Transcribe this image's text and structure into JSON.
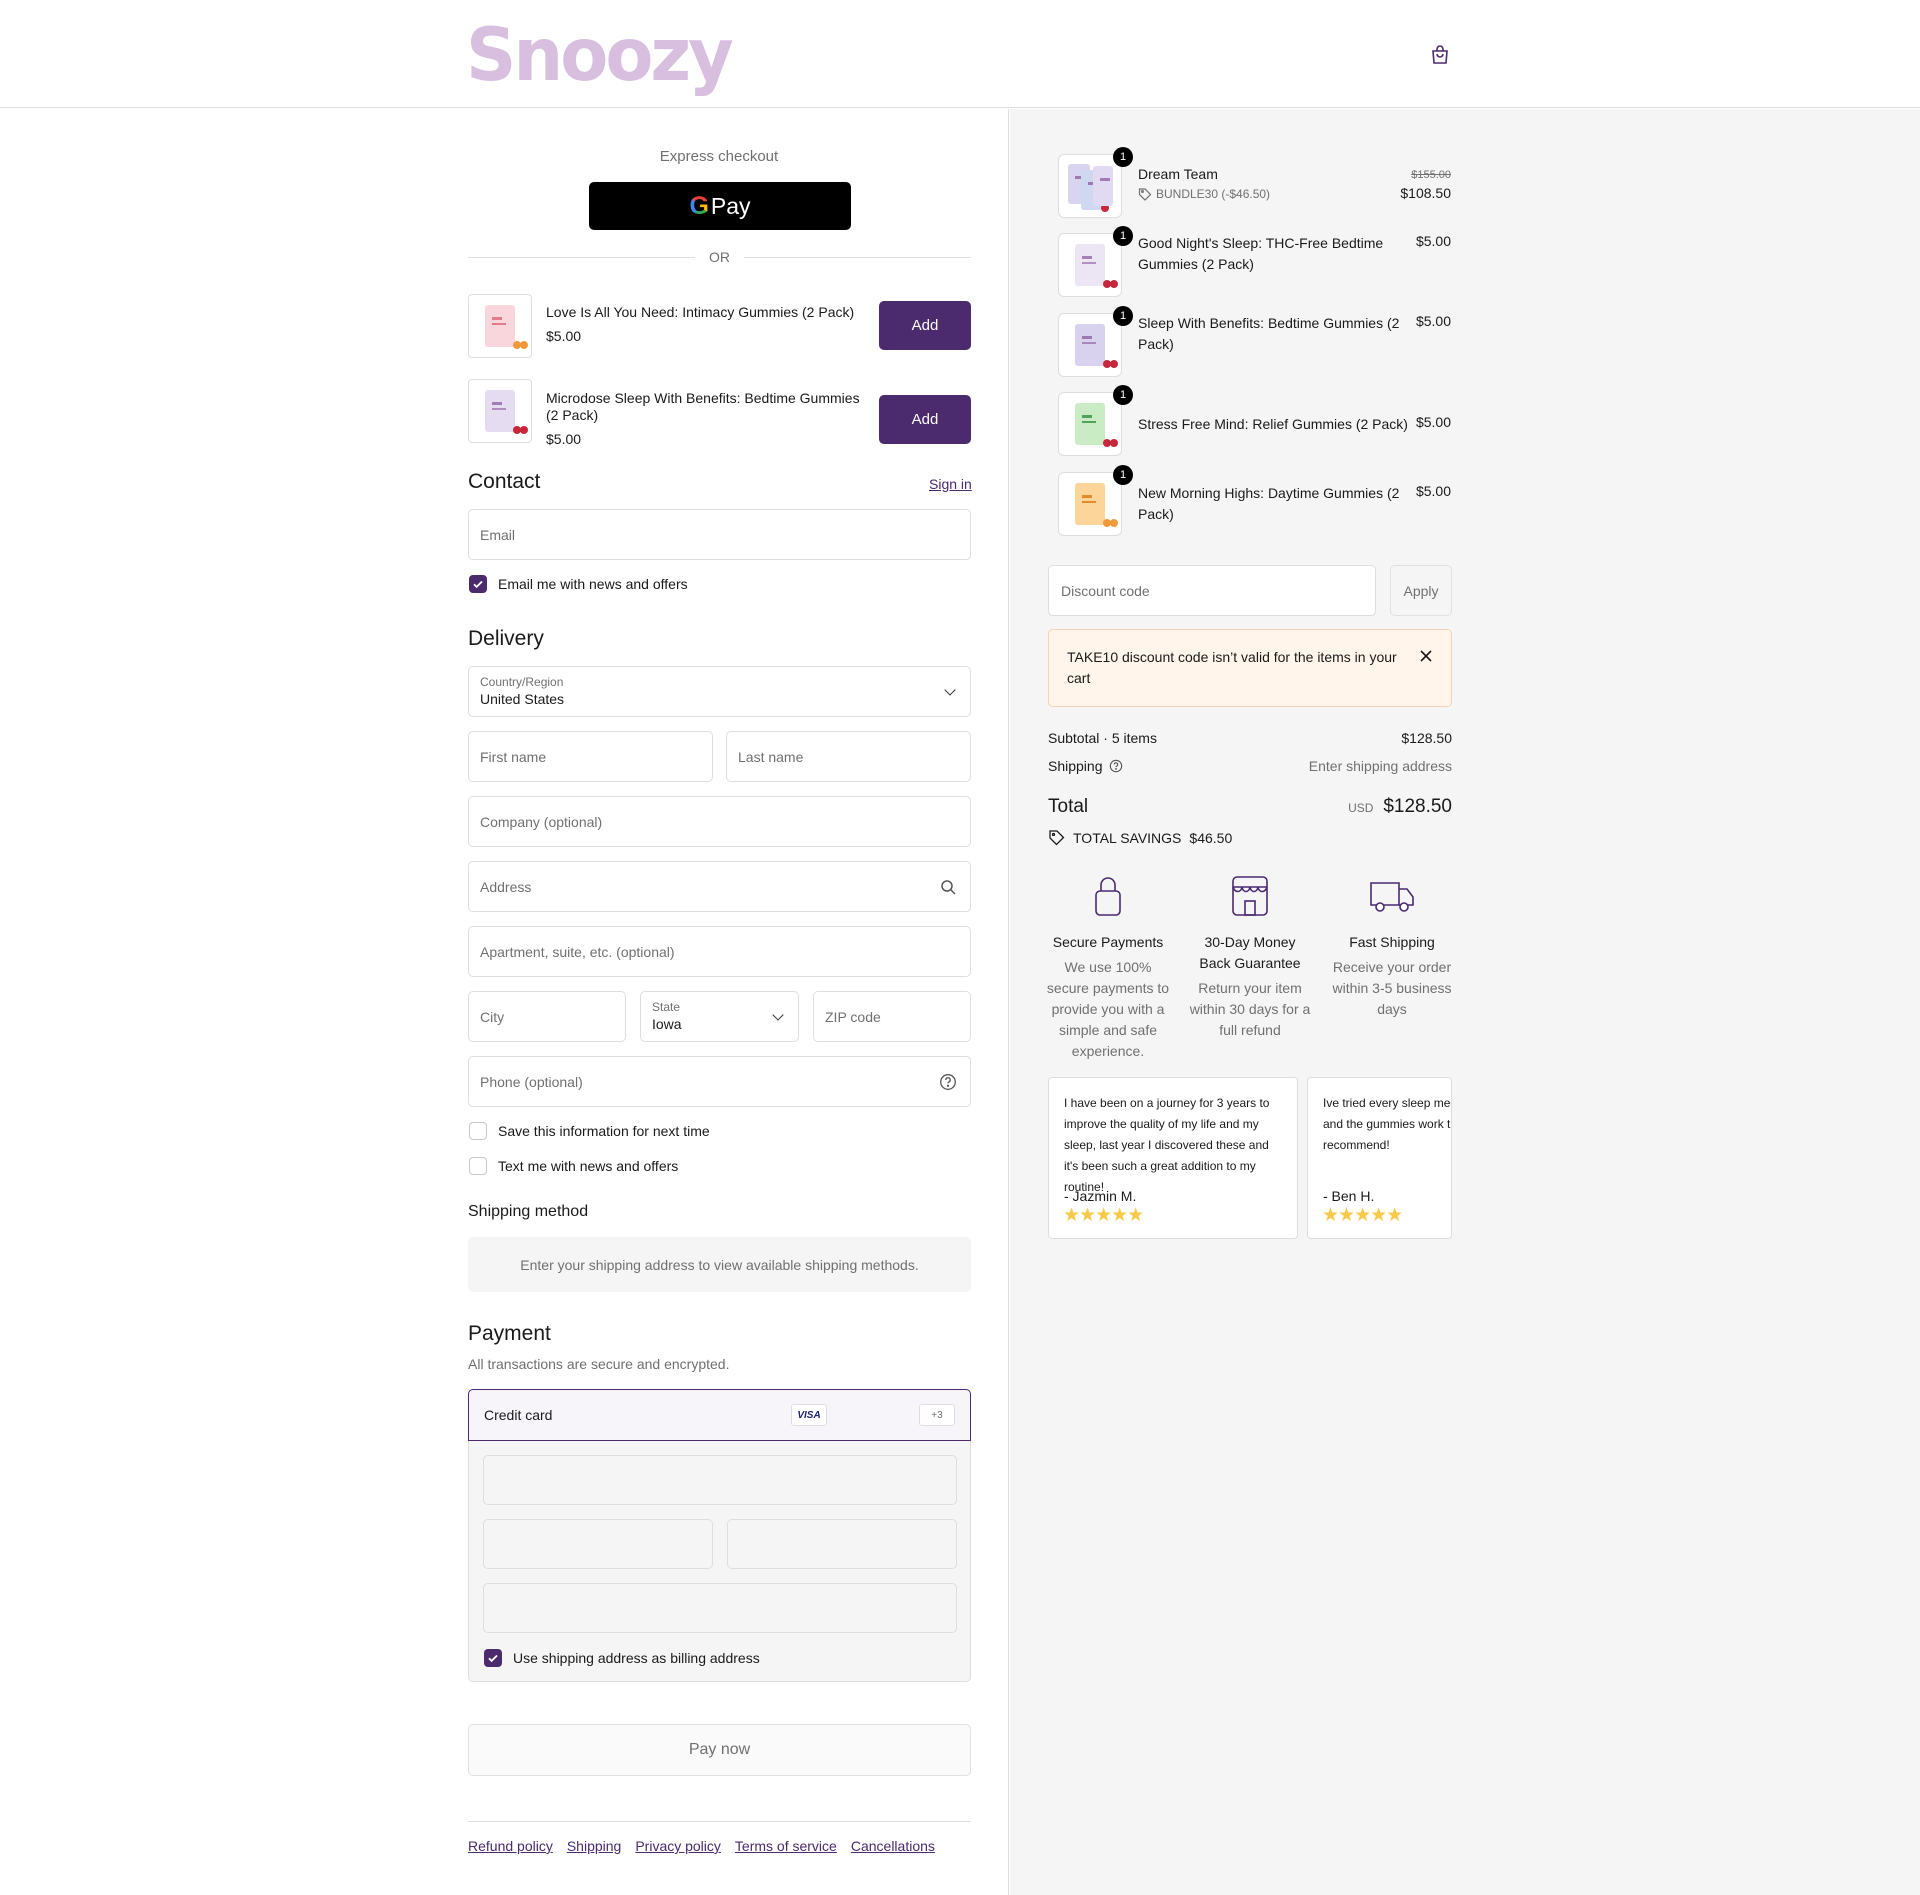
{
  "brand": {
    "name": "Snoozy"
  },
  "colors": {
    "accent": "#4b2a6e",
    "logo": "#d8bfe0",
    "star": "#f7c948",
    "alert_bg": "#fff5ea"
  },
  "express": {
    "label": "Express checkout",
    "gpay_g": "G",
    "gpay_text": "Pay",
    "or": "OR"
  },
  "upsells": [
    {
      "title": "Love Is All You Need: Intimacy Gummies (2 Pack)",
      "price": "$5.00",
      "button": "Add"
    },
    {
      "title": "Microdose Sleep With Benefits: Bedtime Gummies (2 Pack)",
      "price": "$5.00",
      "button": "Add"
    }
  ],
  "contact": {
    "heading": "Contact",
    "sign_in": "Sign in",
    "email_placeholder": "Email",
    "news_checkbox": "Email me with news and offers",
    "news_checked": true
  },
  "delivery": {
    "heading": "Delivery",
    "country_label": "Country/Region",
    "country_value": "United States",
    "first_name": "First name",
    "last_name": "Last name",
    "company": "Company (optional)",
    "address": "Address",
    "apartment": "Apartment, suite, etc. (optional)",
    "city": "City",
    "state_label": "State",
    "state_value": "Iowa",
    "zip": "ZIP code",
    "phone": "Phone (optional)",
    "save_info": "Save this information for next time",
    "text_me": "Text me with news and offers"
  },
  "shipping_method": {
    "heading": "Shipping method",
    "message": "Enter your shipping address to view available shipping methods."
  },
  "payment": {
    "heading": "Payment",
    "subtitle": "All transactions are secure and encrypted.",
    "method_label": "Credit card",
    "card_brand": "VISA",
    "more_brands": "+3",
    "billing_checkbox": "Use shipping address as billing address",
    "billing_checked": true,
    "pay_button": "Pay now"
  },
  "footer_links": [
    "Refund policy",
    "Shipping",
    "Privacy policy",
    "Terms of service",
    "Cancellations"
  ],
  "order_items": [
    {
      "name": "Dream Team",
      "qty": "1",
      "discount": "BUNDLE30 (-$46.50)",
      "original_price": "$155.00",
      "price": "$108.50"
    },
    {
      "name": "Good Night's Sleep: THC-Free Bedtime Gummies (2 Pack)",
      "qty": "1",
      "price": "$5.00"
    },
    {
      "name": "Sleep With Benefits: Bedtime Gummies (2 Pack)",
      "qty": "1",
      "price": "$5.00"
    },
    {
      "name": "Stress Free Mind: Relief Gummies (2 Pack)",
      "qty": "1",
      "price": "$5.00"
    },
    {
      "name": "New Morning Highs: Daytime Gummies (2 Pack)",
      "qty": "1",
      "price": "$5.00"
    }
  ],
  "discount": {
    "placeholder": "Discount code",
    "apply": "Apply",
    "error": "TAKE10 discount code isn’t valid for the items in your cart"
  },
  "summary": {
    "subtotal_label": "Subtotal · 5 items",
    "subtotal_value": "$128.50",
    "shipping_label": "Shipping",
    "shipping_value": "Enter shipping address",
    "total_label": "Total",
    "currency": "USD",
    "total_value": "$128.50",
    "savings_label": "TOTAL SAVINGS",
    "savings_value": "$46.50"
  },
  "badges": [
    {
      "title": "Secure Payments",
      "desc": "We use 100% secure payments to provide you with a simple and safe experience."
    },
    {
      "title": "30-Day Money Back Guarantee",
      "desc": "Return your item within 30 days for a full refund"
    },
    {
      "title": "Fast Shipping",
      "desc": "Receive your order within 3-5 business days"
    }
  ],
  "reviews": [
    {
      "text": "I have been on a journey for 3 years to improve the quality of my life and my sleep, last year I discovered these and it's been such a great addition to my routine!",
      "author": "- Jazmin M.",
      "stars": "★★★★★",
      "rating": 5
    },
    {
      "text": "Ive tried every sleep med under the sun and the gummies work the most. Highly recommend!",
      "author": "- Ben H.",
      "stars": "★★★★★",
      "rating": 5
    }
  ]
}
